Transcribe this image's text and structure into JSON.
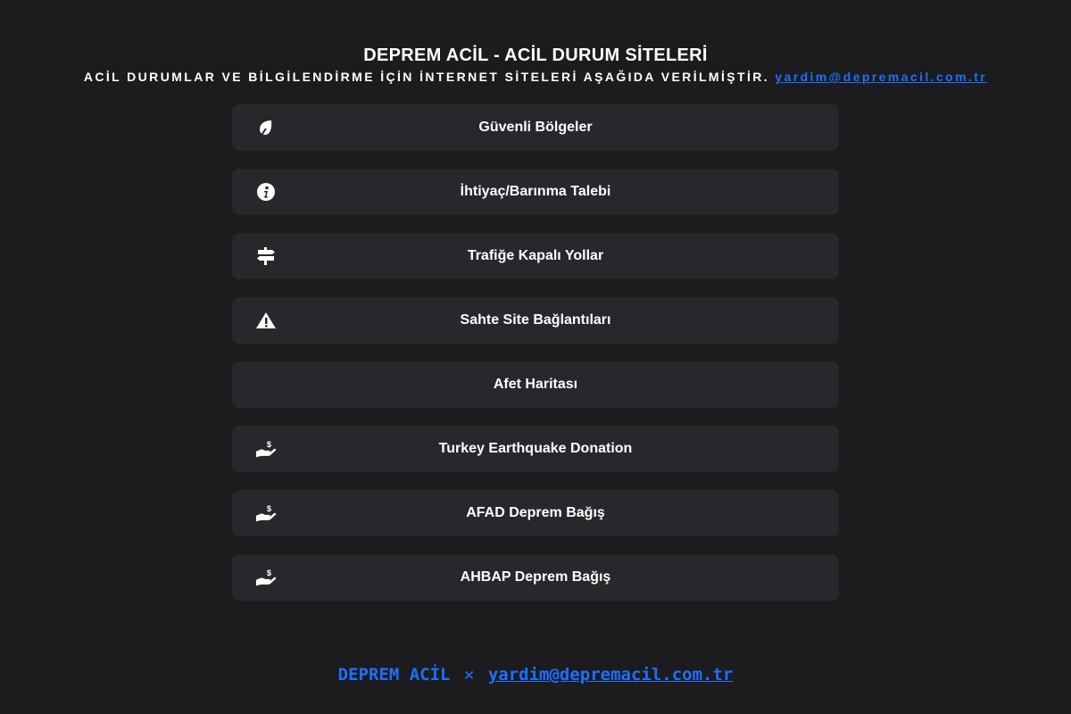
{
  "header": {
    "title": "DEPREM ACİL - ACİL DURUM SİTELERİ",
    "subtitle": "ACİL DURUMLAR VE BİLGİLENDİRME İÇİN İNTERNET SİTELERİ AŞAĞIDA VERİLMİŞTİR.",
    "email": "yardim@depremacil.com.tr"
  },
  "items": [
    {
      "label": "Güvenli Bölgeler",
      "icon": "leaf-pin-icon"
    },
    {
      "label": "İhtiyaç/Barınma Talebi",
      "icon": "info-icon"
    },
    {
      "label": "Trafiğe Kapalı Yollar",
      "icon": "signpost-icon"
    },
    {
      "label": "Sahte Site Bağlantıları",
      "icon": "warning-icon"
    },
    {
      "label": "Afet Haritası",
      "icon": ""
    },
    {
      "label": "Turkey Earthquake Donation",
      "icon": "donation-hand-icon"
    },
    {
      "label": "AFAD Deprem Bağış",
      "icon": "donation-hand-icon"
    },
    {
      "label": "AHBAP Deprem Bağış",
      "icon": "donation-hand-icon"
    }
  ],
  "footer": {
    "brand": "DEPREM ACİL",
    "separator": "✕",
    "email": "yardim@depremacil.com.tr"
  },
  "colors": {
    "background": "#1c1c1e",
    "card": "#28282c",
    "accent": "#1e6fff",
    "text": "#ffffff"
  }
}
